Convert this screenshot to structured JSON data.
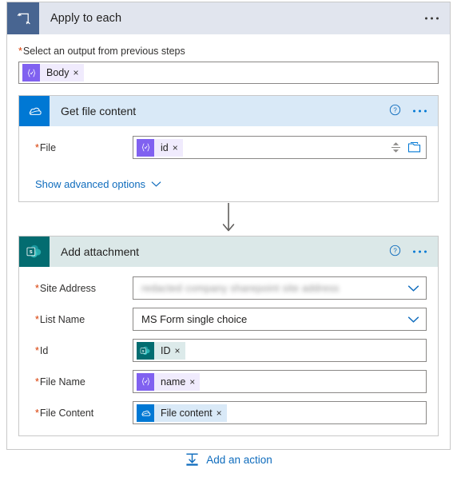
{
  "loop": {
    "title": "Apply to each",
    "icon": "loop-repeat-icon",
    "more_label": "…",
    "select_output_label": "Select an output from previous steps",
    "required_marker": "*",
    "selected_token": {
      "text": "Body",
      "icon": "expression-token-icon",
      "remove_label": "×"
    }
  },
  "get_file_content": {
    "title": "Get file content",
    "icon": "onedrive-icon",
    "help_label": "?",
    "more_label": "…",
    "fields": [
      {
        "label": "File",
        "required_marker": "*",
        "token": {
          "text": "id",
          "icon": "expression-token-icon",
          "remove_label": "×"
        },
        "trailing_icons": [
          "spinner-up-down-icon",
          "folder-picker-icon"
        ]
      }
    ],
    "advanced_link": "Show advanced options",
    "advanced_chevron": "chevron-down-icon"
  },
  "connector": {
    "icon": "down-arrow-icon"
  },
  "add_attachment": {
    "title": "Add attachment",
    "icon": "sharepoint-icon",
    "help_label": "?",
    "more_label": "…",
    "site_address": {
      "label": "Site Address",
      "required_marker": "*",
      "value": "redacted company sharepoint site address",
      "redacted": true,
      "chevron": "chevron-down-icon"
    },
    "list_name": {
      "label": "List Name",
      "required_marker": "*",
      "value": "MS Form single choice",
      "chevron": "chevron-down-icon"
    },
    "id_field": {
      "label": "Id",
      "required_marker": "*",
      "token": {
        "text": "ID",
        "icon": "sharepoint-token-icon",
        "remove_label": "×"
      }
    },
    "file_name": {
      "label": "File Name",
      "required_marker": "*",
      "token": {
        "text": "name",
        "icon": "expression-token-icon",
        "remove_label": "×"
      }
    },
    "file_content": {
      "label": "File Content",
      "required_marker": "*",
      "token": {
        "text": "File content",
        "icon": "onedrive-token-icon",
        "remove_label": "×"
      }
    }
  },
  "footer": {
    "add_action_label": "Add an action",
    "add_action_icon": "add-action-icon"
  },
  "colors": {
    "loop_header_bg": "#e1e5ee",
    "loop_icon_bg": "#486591",
    "onedrive_blue": "#0078d4",
    "onedrive_header_bg": "#d9e9f7",
    "sharepoint_teal": "#036c70",
    "sharepoint_header_bg": "#dbe8e8",
    "expression_purple": "#8061f0",
    "link_blue": "#0f6cbd",
    "required_red": "#d83b01"
  }
}
